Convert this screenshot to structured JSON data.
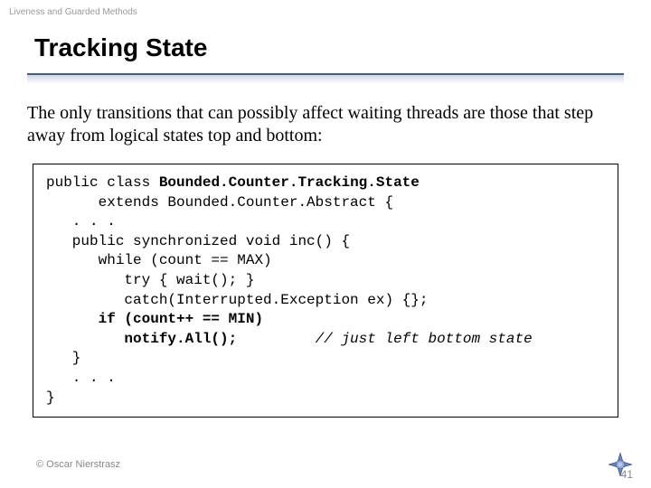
{
  "breadcrumb": "Liveness and Guarded Methods",
  "title": "Tracking State",
  "body": "The only transitions that can possibly affect waiting threads are those that step away from logical states top and bottom:",
  "code": {
    "l1a": "public class ",
    "l1b": "Bounded.Counter.Tracking.State",
    "l2": "      extends Bounded.Counter.Abstract {",
    "l3": "   . . .",
    "l4": "   public synchronized void inc() {",
    "l5": "      while (count == MAX)",
    "l6": "         try { wait(); }",
    "l7": "         catch(Interrupted.Exception ex) {};",
    "l8": "      if (count++ == MIN)",
    "l9a": "         notify.All();",
    "l9b": "         // just left bottom state",
    "l10": "   }",
    "l11": "   . . .",
    "l12": "}"
  },
  "footer": {
    "copyright": "© Oscar Nierstrasz",
    "page": "41"
  }
}
